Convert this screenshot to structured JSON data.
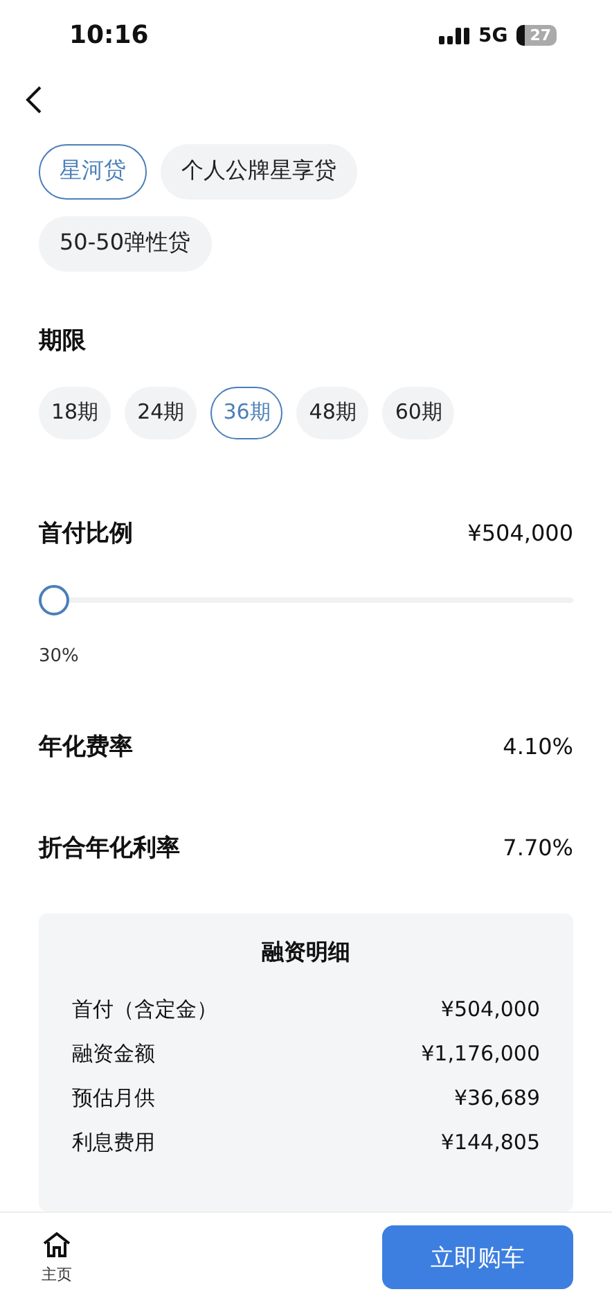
{
  "status_bar": {
    "time": "10:16",
    "network": "5G",
    "battery": "27"
  },
  "loan_types": [
    {
      "label": "星河贷",
      "selected": true
    },
    {
      "label": "个人公牌星享贷",
      "selected": false
    },
    {
      "label": "50-50弹性贷",
      "selected": false
    }
  ],
  "term": {
    "title": "期限",
    "options": [
      {
        "label": "18期",
        "selected": false
      },
      {
        "label": "24期",
        "selected": false
      },
      {
        "label": "36期",
        "selected": true
      },
      {
        "label": "48期",
        "selected": false
      },
      {
        "label": "60期",
        "selected": false
      }
    ]
  },
  "down_payment": {
    "title": "首付比例",
    "amount": "¥504,000",
    "level": 0,
    "reading": "30%"
  },
  "rates": [
    {
      "label": "年化费率",
      "value": "4.10%"
    },
    {
      "label": "折合年化利率",
      "value": "7.70%"
    }
  ],
  "details": {
    "title": "融资明细",
    "rows": [
      {
        "label": "首付（含定金）",
        "value": "¥504,000"
      },
      {
        "label": "融资金额",
        "value": "¥1,176,000"
      },
      {
        "label": "预估月供",
        "value": "¥36,689"
      },
      {
        "label": "利息费用",
        "value": "¥144,805"
      }
    ]
  },
  "bottom_bar": {
    "home": "主页",
    "buy_button": "立即购车"
  }
}
